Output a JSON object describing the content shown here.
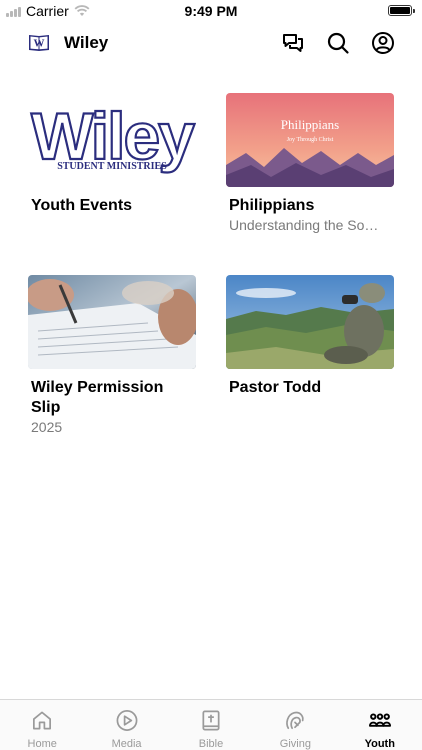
{
  "status_bar": {
    "carrier": "Carrier",
    "time": "9:49 PM"
  },
  "header": {
    "title": "Wiley",
    "icons": [
      "chat-icon",
      "search-icon",
      "account-icon"
    ]
  },
  "cards": [
    {
      "title": "Youth Events",
      "subtitle": "",
      "thumb_text": "Wiley",
      "thumb_subtext": "STUDENT MINISTRIES"
    },
    {
      "title": "Philippians",
      "subtitle": "Understanding the So…",
      "thumb_text": "Philippians",
      "thumb_subtext": "Joy Through Christ"
    },
    {
      "title": "Wiley Permission Slip",
      "subtitle": "2025"
    },
    {
      "title": "Pastor Todd",
      "subtitle": ""
    }
  ],
  "tabs": [
    {
      "label": "Home",
      "icon": "home-icon",
      "active": false
    },
    {
      "label": "Media",
      "icon": "play-icon",
      "active": false
    },
    {
      "label": "Bible",
      "icon": "bible-icon",
      "active": false
    },
    {
      "label": "Giving",
      "icon": "giving-icon",
      "active": false
    },
    {
      "label": "Youth",
      "icon": "group-icon",
      "active": true
    }
  ],
  "colors": {
    "brand_navy": "#2b2d7e",
    "inactive_tab": "#9a9a9a",
    "active_tab": "#000000"
  }
}
